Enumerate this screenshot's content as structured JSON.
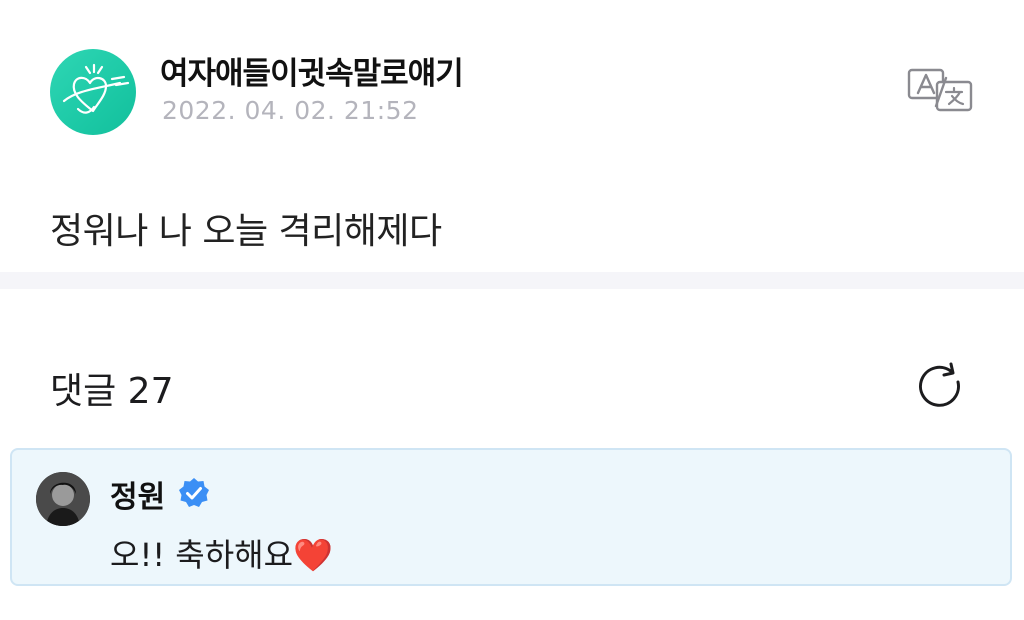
{
  "post": {
    "author_name": "여자애들이귓속말로얘기",
    "timestamp": "2022. 04. 02. 21:52",
    "body": "정워나 나 오늘 격리해제다",
    "avatar_icon": "heart-doodle-logo",
    "translate_icon": "translate-icon"
  },
  "comments": {
    "title": "댓글 27",
    "refresh_icon": "refresh-icon",
    "items": [
      {
        "author": "정원",
        "verified": true,
        "text": "오!! 축하해요",
        "emoji": "❤️"
      }
    ]
  },
  "colors": {
    "avatar_teal": "#1cc9a6",
    "verified_blue": "#3b8ff5",
    "comment_bg": "#edf7fc",
    "comment_border": "#cfe5f4",
    "timestamp_gray": "#b4b4bc",
    "heart_red": "#d6182b"
  }
}
